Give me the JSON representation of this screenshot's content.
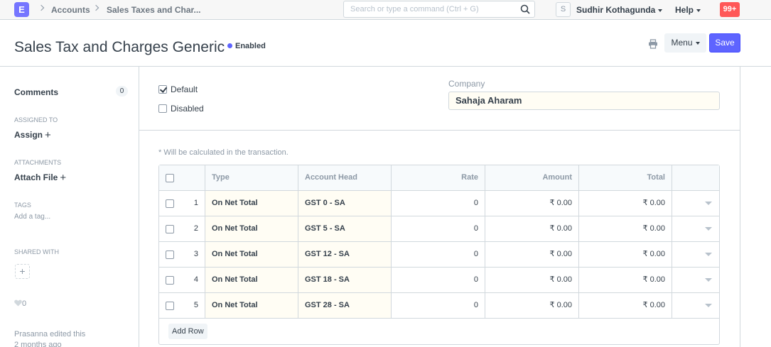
{
  "navbar": {
    "logo_letter": "E",
    "breadcrumbs": [
      "Accounts",
      "Sales Taxes and Char..."
    ],
    "search_placeholder": "Search or type a command (Ctrl + G)",
    "user_initial": "S",
    "user_name": "Sudhir Kothagunda",
    "help_label": "Help",
    "notification_count": "99+"
  },
  "page": {
    "title": "Sales Tax and Charges Generic",
    "status": "Enabled",
    "menu_label": "Menu",
    "save_label": "Save"
  },
  "sidebar": {
    "comments_label": "Comments",
    "comments_count": "0",
    "assigned_to_label": "ASSIGNED TO",
    "assign_label": "Assign",
    "attachments_label": "ATTACHMENTS",
    "attach_file_label": "Attach File",
    "tags_label": "TAGS",
    "add_tag_label": "Add a tag...",
    "shared_with_label": "SHARED WITH",
    "share_add": "+",
    "likes_count": "0",
    "edited_by": "Prasanna",
    "edited_text": "edited this",
    "edited_when": "2 months ago"
  },
  "form": {
    "default_label": "Default",
    "default_checked": true,
    "disabled_label": "Disabled",
    "disabled_checked": false,
    "company_label": "Company",
    "company_value": "Sahaja Aharam",
    "calc_note": "* Will be calculated in the transaction."
  },
  "taxes_table": {
    "headers": {
      "type": "Type",
      "account_head": "Account Head",
      "rate": "Rate",
      "amount": "Amount",
      "total": "Total"
    },
    "rows": [
      {
        "idx": "1",
        "type": "On Net Total",
        "account_head": "GST 0 - SA",
        "rate": "0",
        "amount": "₹ 0.00",
        "total": "₹ 0.00"
      },
      {
        "idx": "2",
        "type": "On Net Total",
        "account_head": "GST 5 - SA",
        "rate": "0",
        "amount": "₹ 0.00",
        "total": "₹ 0.00"
      },
      {
        "idx": "3",
        "type": "On Net Total",
        "account_head": "GST 12 - SA",
        "rate": "0",
        "amount": "₹ 0.00",
        "total": "₹ 0.00"
      },
      {
        "idx": "4",
        "type": "On Net Total",
        "account_head": "GST 18 - SA",
        "rate": "0",
        "amount": "₹ 0.00",
        "total": "₹ 0.00"
      },
      {
        "idx": "5",
        "type": "On Net Total",
        "account_head": "GST 28 - SA",
        "rate": "0",
        "amount": "₹ 0.00",
        "total": "₹ 0.00"
      }
    ],
    "add_row_label": "Add Row"
  },
  "colors": {
    "primary": "#5e64ff",
    "notification": "#ff5858",
    "link_field_bg": "#fffdf4"
  }
}
